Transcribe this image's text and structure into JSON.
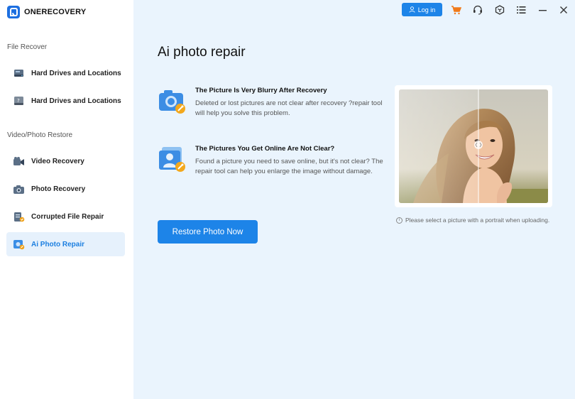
{
  "app": {
    "name": "ONERECOVERY"
  },
  "sidebar": {
    "sections": [
      {
        "label": "File Recover"
      },
      {
        "label": "Video/Photo Restore"
      }
    ],
    "items": [
      {
        "label": "Hard Drives and Locations",
        "icon": "hard-drive-icon"
      },
      {
        "label": "Hard Drives and Locations",
        "icon": "hard-drive-warning-icon"
      },
      {
        "label": "Video Recovery",
        "icon": "video-camera-icon"
      },
      {
        "label": "Photo Recovery",
        "icon": "camera-icon"
      },
      {
        "label": "Corrupted File Repair",
        "icon": "file-repair-icon"
      },
      {
        "label": "Ai Photo Repair",
        "icon": "ai-photo-icon",
        "active": true
      }
    ]
  },
  "topbar": {
    "login_label": "Log in",
    "icons": [
      "cart-icon",
      "headset-icon",
      "cube-icon",
      "menu-icon",
      "minimize-icon",
      "close-icon"
    ]
  },
  "main": {
    "title": "Ai photo repair",
    "features": [
      {
        "title": "The Picture Is Very Blurry After Recovery",
        "description": "Deleted or lost pictures are not clear after recovery ?repair tool will help you solve this problem."
      },
      {
        "title": "The Pictures You Get Online Are Not Clear?",
        "description": "Found a picture you need to save online, but it's not clear? The repair tool can help you enlarge the image without damage."
      }
    ],
    "restore_label": "Restore Photo Now",
    "photo_note": "Please select a picture with a portrait when uploading."
  },
  "colors": {
    "accent": "#1d84e8",
    "active_bg": "#e6f1fc",
    "main_bg": "#eaf4fd",
    "cart": "#f07a1a"
  }
}
